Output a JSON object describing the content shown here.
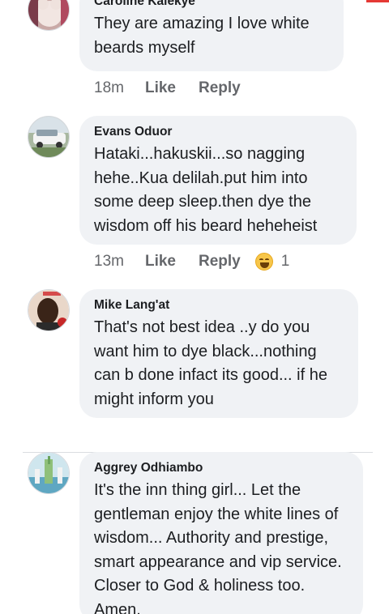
{
  "colors": {
    "bubble": "#f0f2f5",
    "meta": "#65676b",
    "text": "#1c1e21",
    "accent": "#e53935"
  },
  "comments": [
    {
      "author": "Caroline Kalekye",
      "text": "They are amazing I love white beards myself",
      "time": "18m",
      "like_label": "Like",
      "reply_label": "Reply",
      "reaction_count": null
    },
    {
      "author": "Evans Oduor",
      "text": "Hataki...hakuskii...so nagging hehe..Kua delilah.put him into some deep sleep.then dye the wisdom off his beard heheheist",
      "time": "13m",
      "like_label": "Like",
      "reply_label": "Reply",
      "reaction_icon": "laughing-emoji-icon",
      "reaction_count": "1"
    },
    {
      "author": "Mike Lang'at",
      "text": "That's not best idea ..y do you want  him to dye black...nothing can b done infact its good... if he might inform you",
      "time": null
    },
    {
      "author": "Aggrey Odhiambo",
      "text": "It's the inn thing girl... Let the gentleman enjoy the white lines of wisdom... Authority and prestige,  smart appearance and vip service. Closer to God & holiness too. Amen.",
      "time": null
    }
  ]
}
